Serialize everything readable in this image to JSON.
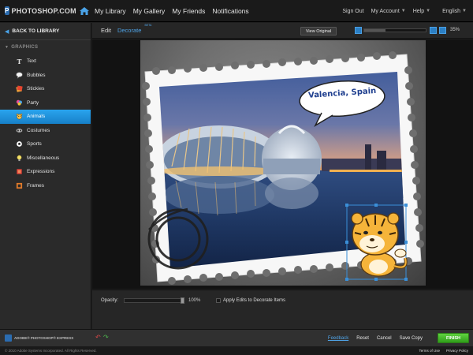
{
  "topbar": {
    "logo_text": "PHOTOSHOP.COM",
    "nav": [
      "My Library",
      "My Gallery",
      "My Friends",
      "Notifications"
    ],
    "sign_out": "Sign Out",
    "my_account": "My Account",
    "help": "Help",
    "language": "English"
  },
  "sidebar": {
    "back_label": "BACK TO LIBRARY",
    "section_label": "GRAPHICS",
    "items": [
      {
        "label": "Text",
        "icon": "text-icon"
      },
      {
        "label": "Bubbles",
        "icon": "bubbles-icon"
      },
      {
        "label": "Stickies",
        "icon": "stickies-icon"
      },
      {
        "label": "Party",
        "icon": "party-icon"
      },
      {
        "label": "Animals",
        "icon": "animals-icon",
        "active": true
      },
      {
        "label": "Costumes",
        "icon": "costumes-icon"
      },
      {
        "label": "Sports",
        "icon": "sports-icon"
      },
      {
        "label": "Miscellaneous",
        "icon": "miscellaneous-icon"
      },
      {
        "label": "Expressions",
        "icon": "expressions-icon"
      },
      {
        "label": "Frames",
        "icon": "frames-icon"
      }
    ]
  },
  "editor": {
    "tab_edit": "Edit",
    "tab_decorate": "Decorate",
    "beta": "BETA",
    "view_original": "View Original",
    "zoom": "35%",
    "zoom_fraction": 0.35
  },
  "canvas": {
    "caption": "Valencia, Spain"
  },
  "opacity": {
    "label": "Opacity:",
    "value": "100%",
    "apply_label": "Apply Edits to Decorate Items"
  },
  "bottombar": {
    "adobe_label": "ADOBE® PHOTOSHOP® EXPRESS",
    "feedback": "Feedback",
    "reset": "Reset",
    "cancel": "Cancel",
    "save_copy": "Save Copy",
    "finish": "FINISH"
  },
  "footer": {
    "copyright": "© 2010 Adobe Systems Incorporated. All Rights Reserved.",
    "terms": "Terms of Use",
    "privacy": "Privacy Policy"
  },
  "colors": {
    "accent": "#1e8fd6",
    "finish_green": "#3fb620",
    "caption_blue": "#1f3f8f"
  }
}
